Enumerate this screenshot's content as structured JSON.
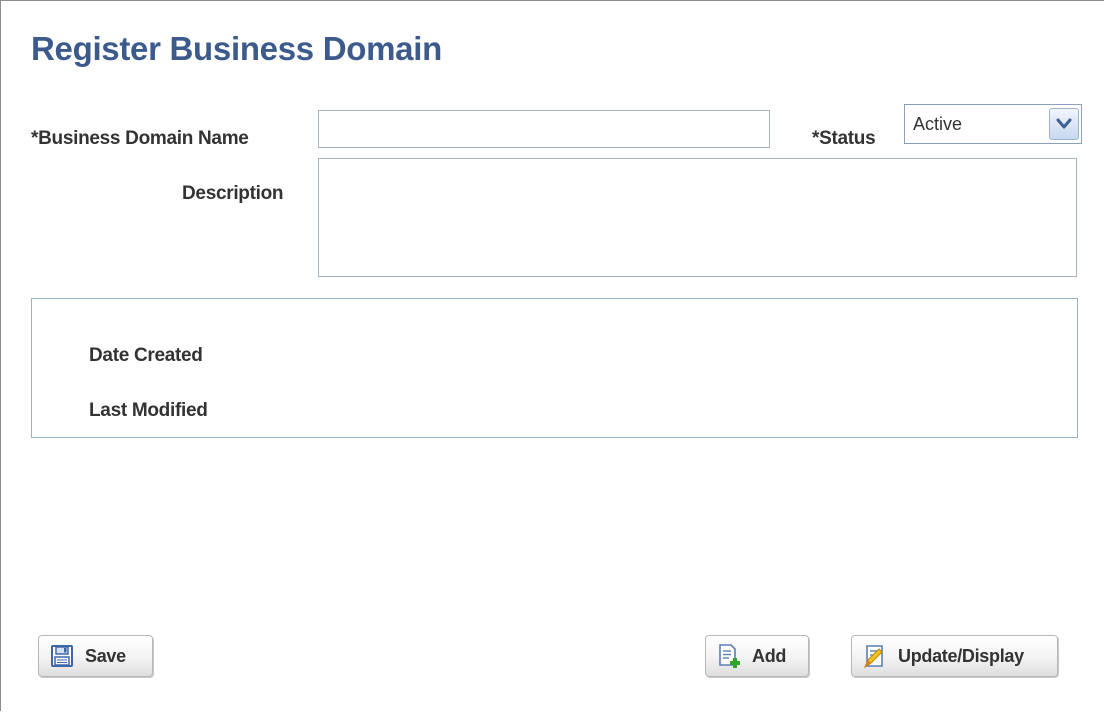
{
  "page": {
    "title": "Register Business Domain"
  },
  "form": {
    "business_domain_name": {
      "label": "*Business Domain Name",
      "value": ""
    },
    "status": {
      "label": "*Status",
      "value": "Active"
    },
    "description": {
      "label": "Description",
      "value": ""
    }
  },
  "info": {
    "date_created_label": "Date Created",
    "last_modified_label": "Last Modified"
  },
  "buttons": {
    "save": "Save",
    "add": "Add",
    "update_display": "Update/Display"
  },
  "icons": {
    "save": "floppy-disk-icon",
    "add": "add-document-icon",
    "update_display": "edit-document-icon",
    "status_dropdown": "chevron-down-icon"
  },
  "colors": {
    "title": "#3c5b8c",
    "field_border": "#a7b3c0",
    "groupbox_border": "#9bb2cf"
  }
}
